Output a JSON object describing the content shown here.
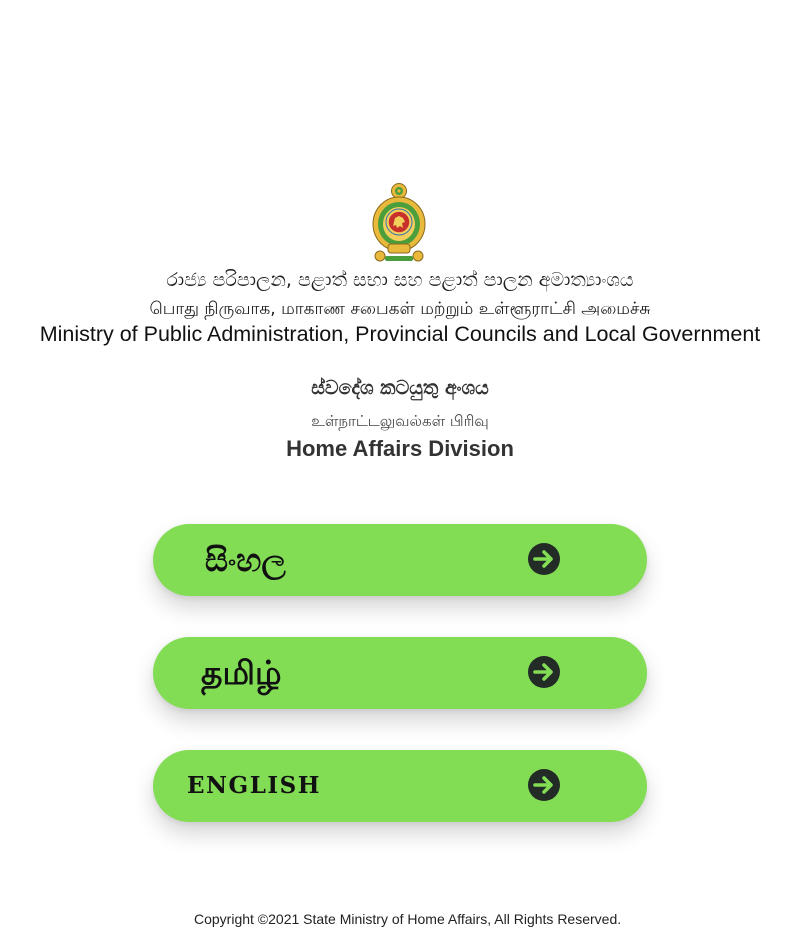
{
  "header": {
    "emblem_icon": "sri-lanka-national-emblem-icon",
    "ministry_name_sinhala": "රාජ්‍ය පරිපාලන, පළාත් සභා සහ පළාත් පාලන අමාත්‍යාංශය",
    "ministry_name_tamil": "பொது நிருவாக, மாகாண சபைகள் மற்றும் உள்ளூராட்சி அமைச்சு",
    "ministry_name_english": "Ministry of Public Administration, Provincial Councils and Local Government",
    "division_name_sinhala": "ස්වදේශ කටයුතු අංශය",
    "division_name_tamil": "உள்நாட்டலுவல்கள் பிரிவு",
    "division_name_english": "Home Affairs Division"
  },
  "languages": [
    {
      "label": "සිංහල",
      "icon": "arrow-right-circle-icon"
    },
    {
      "label": "தமிழ்",
      "icon": "arrow-right-circle-icon"
    },
    {
      "label": "ENGLISH",
      "icon": "arrow-right-circle-icon"
    }
  ],
  "footer": {
    "copyright": "Copyright ©2021 State Ministry of Home Affairs, All Rights Reserved."
  },
  "colors": {
    "button_green": "#82dd55",
    "arrow_dark": "#222b26",
    "text_dark": "#222222",
    "emblem_gold": "#e8b93a",
    "emblem_green": "#4a9e3c",
    "emblem_red": "#c8312b"
  }
}
